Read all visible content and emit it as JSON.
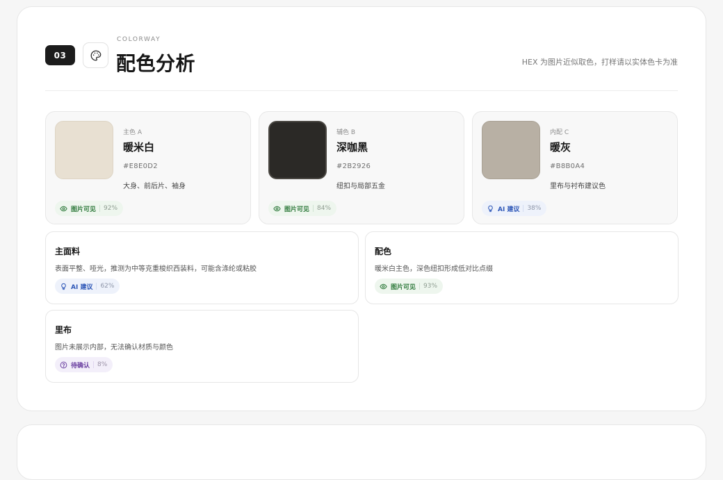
{
  "header": {
    "step": "03",
    "eyebrow": "COLORWAY",
    "title": "配色分析",
    "hint": "HEX 为图片近似取色，打样请以实体色卡为准"
  },
  "colors": [
    {
      "role": "主色 A",
      "name": "暖米白",
      "hex": "#E8E0D2",
      "usage": "大身、前后片、袖身",
      "badge": {
        "kind": "green",
        "icon": "eye-icon",
        "label": "图片可见",
        "pct": "92%"
      }
    },
    {
      "role": "辅色 B",
      "name": "深咖黑",
      "hex": "#2B2926",
      "usage": "纽扣与局部五金",
      "badge": {
        "kind": "green",
        "icon": "eye-icon",
        "label": "图片可见",
        "pct": "84%"
      }
    },
    {
      "role": "内配 C",
      "name": "暖灰",
      "hex": "#B8B0A4",
      "usage": "里布与衬布建议色",
      "badge": {
        "kind": "blue",
        "icon": "lightbulb-icon",
        "label": "AI 建议",
        "pct": "38%"
      }
    }
  ],
  "details": [
    {
      "title": "主面料",
      "desc": "表面平整、哑光，推测为中等克重梭织西装料，可能含涤纶或粘胶",
      "badge": {
        "kind": "blue",
        "icon": "lightbulb-icon",
        "label": "AI 建议",
        "pct": "62%"
      }
    },
    {
      "title": "配色",
      "desc": "暖米白主色，深色纽扣形成低对比点缀",
      "badge": {
        "kind": "green",
        "icon": "eye-icon",
        "label": "图片可见",
        "pct": "93%"
      }
    },
    {
      "title": "里布",
      "desc": "图片未展示内部，无法确认材质与颜色",
      "badge": {
        "kind": "purple",
        "icon": "question-circle-icon",
        "label": "待确认",
        "pct": "8%"
      }
    }
  ],
  "icons": {
    "header": "palette-icon"
  }
}
